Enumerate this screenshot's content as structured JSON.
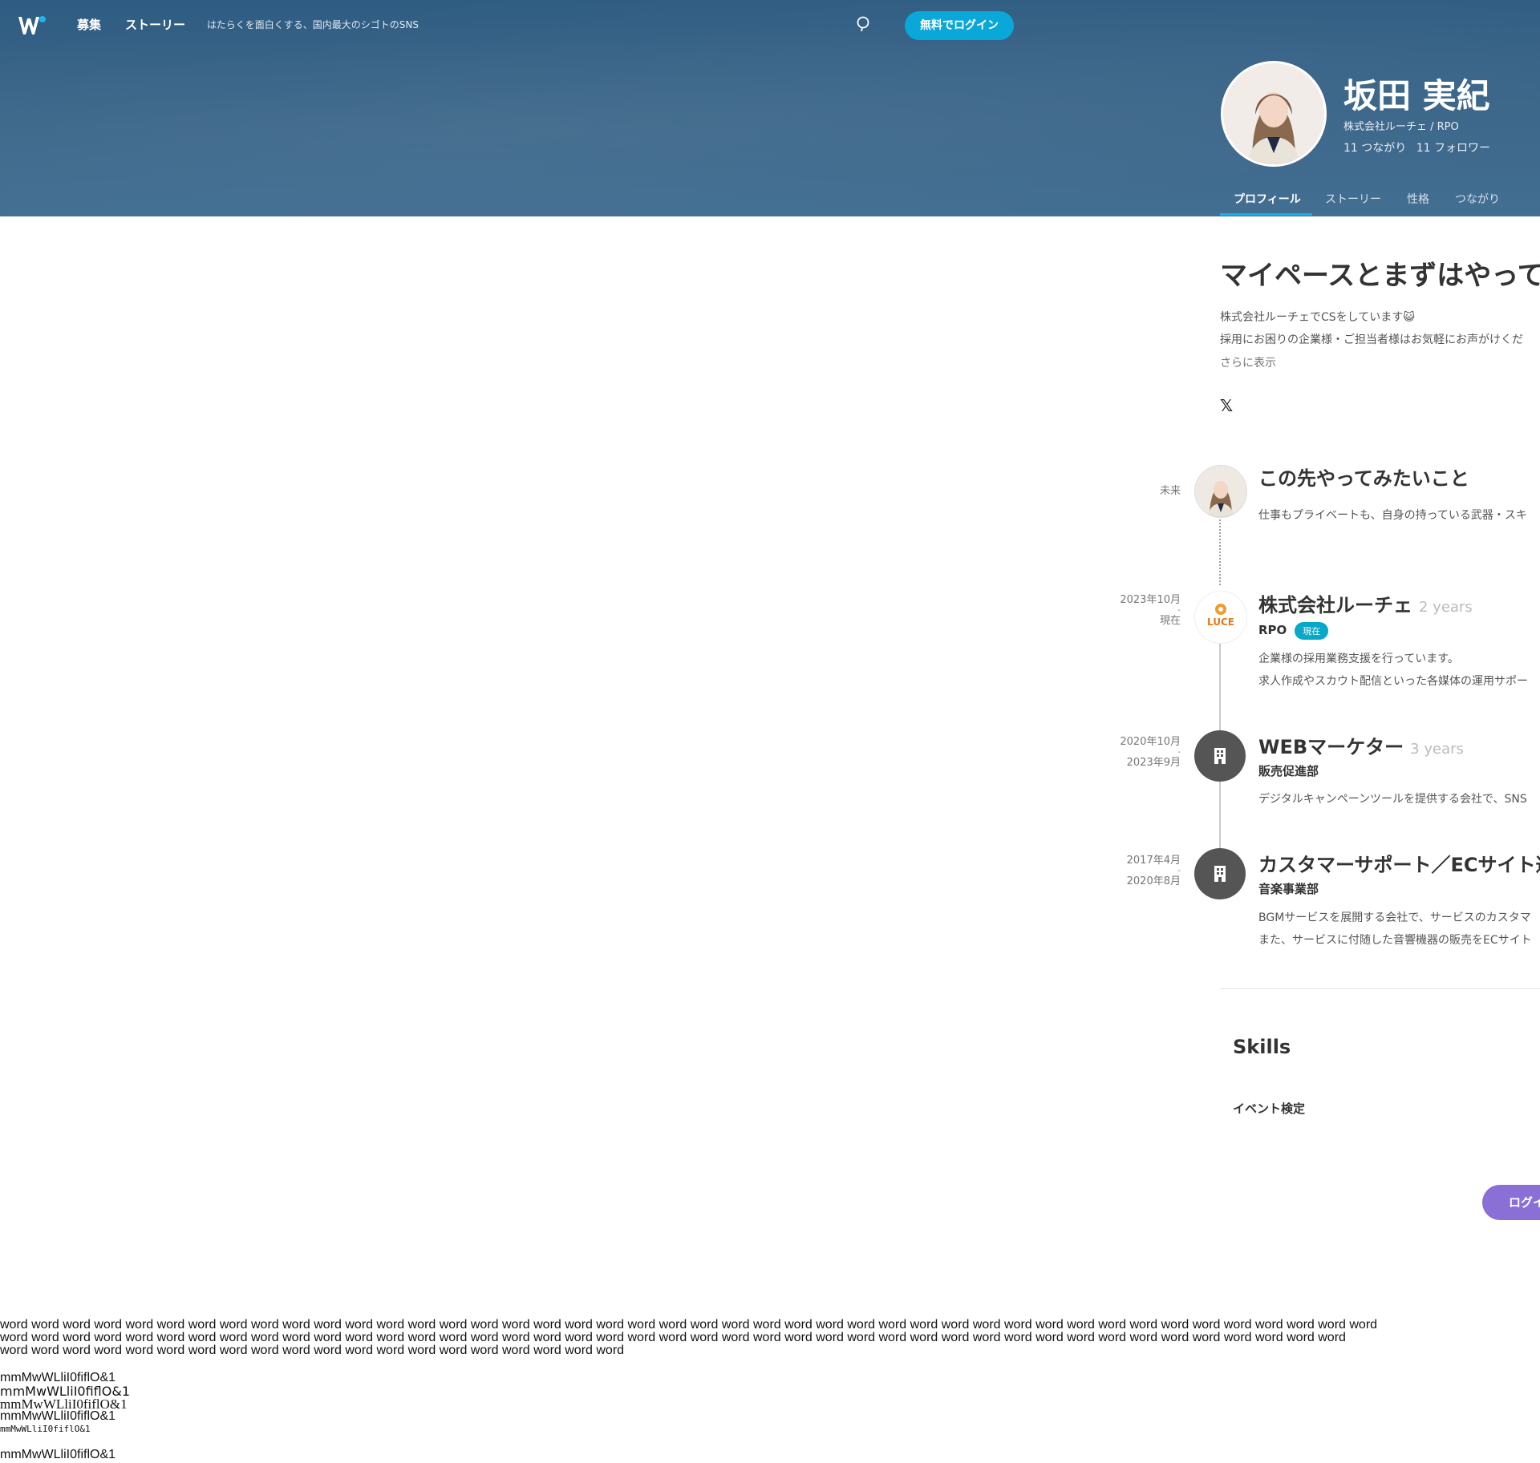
{
  "header": {
    "nav_recruit": "募集",
    "nav_story": "ストーリー",
    "tagline": "はたらくを面白くする、国内最大のシゴトのSNS",
    "login_label": "無料でログイン"
  },
  "profile": {
    "name": "坂田 実紀",
    "affiliation": "株式会社ルーチェ / RPO",
    "connections": "11 つながり",
    "followers": "11 フォロワー",
    "tabs": [
      "プロフィール",
      "ストーリー",
      "性格",
      "つながり"
    ],
    "headline": "マイペースとまずはやってみ",
    "intro_lines": [
      "株式会社ルーチェでCSをしています😺",
      "採用にお困りの企業様・ご担当者様はお気軽にお声がけくだ"
    ],
    "more_label": "さらに表示",
    "social_icon": "x-icon"
  },
  "timeline": {
    "future": {
      "date": "未来",
      "title": "この先やってみたいこと",
      "desc": "仕事もプライベートも、自身の持っている武器・スキ"
    },
    "items": [
      {
        "date_from": "2023年10月",
        "date_sep": "-",
        "date_to": "現在",
        "title": "株式会社ルーチェ",
        "years": "2 years",
        "role": "RPO",
        "badge": "現在",
        "desc_lines": [
          "企業様の採用業務支援を行っています。",
          "求人作成やスカウト配信といった各媒体の運用サポー"
        ],
        "logo_text": "LUCE"
      },
      {
        "date_from": "2020年10月",
        "date_sep": "-",
        "date_to": "2023年9月",
        "title": "WEBマーケター",
        "years": "3 years",
        "role": "販売促進部",
        "desc_lines": [
          "デジタルキャンペーンツールを提供する会社で、SNS"
        ]
      },
      {
        "date_from": "2017年4月",
        "date_sep": "-",
        "date_to": "2020年8月",
        "title": "カスタマーサポート／ECサイト運",
        "role": "音楽事業部",
        "desc_lines": [
          "BGMサービスを展開する会社で、サービスのカスタマ",
          "また、サービスに付随した音響機器の販売をECサイト"
        ]
      }
    ]
  },
  "skills": {
    "title": "Skills",
    "items": [
      "イベント検定"
    ]
  },
  "floating_login": "ログイン",
  "filler": {
    "line1": "word word word word word word word word word word word word word word word word word word word word word word word word word word word word word word word word word word word word word word word word word word word word",
    "line2": "word word word word word word word word word word word word word word word word word word word word word word word word word word word word word word word word word word word word word word word word word word word",
    "line3": "word word word word word word word word word word word word word word word word word word word word",
    "probe": "mmMwWLliI0fiflO&1"
  }
}
